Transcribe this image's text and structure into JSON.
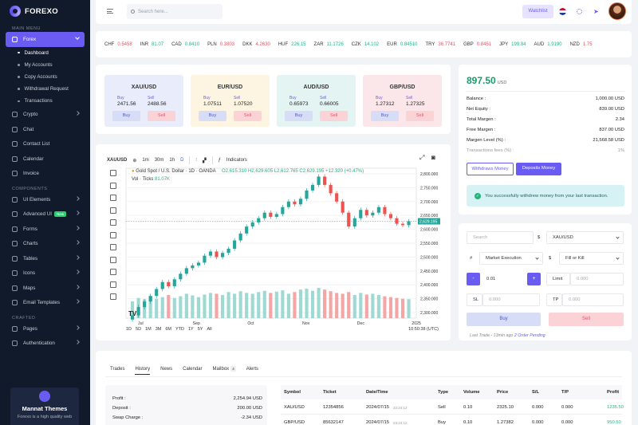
{
  "brand": "FOREXO",
  "sidebar": {
    "main_menu": "MAIN MENU",
    "forex": "Forex",
    "forex_sub": [
      "Dashboard",
      "My Accounts",
      "Copy Accounts",
      "Withdrawal Request",
      "Transactions"
    ],
    "items1": [
      "Crypto",
      "Chat",
      "Contact List",
      "Calendar",
      "Invoice"
    ],
    "components": "COMPONENTS",
    "items2": [
      "UI Elements",
      "Advanced UI",
      "Forms",
      "Charts",
      "Tables",
      "Icons",
      "Maps",
      "Email Templates"
    ],
    "new_badge": "New",
    "crafted": "CRAFTED",
    "items3": [
      "Pages",
      "Authentication"
    ],
    "promo_title": "Mannat Themes",
    "promo_text": "Forexo is a high quality web"
  },
  "topbar": {
    "search_placeholder": "Search here...",
    "watchlist": "Watchlist"
  },
  "ticker": [
    {
      "sym": "CHF",
      "val": "0.5458",
      "dir": "dn"
    },
    {
      "sym": "INR",
      "val": "81.07",
      "dir": "up"
    },
    {
      "sym": "CAD",
      "val": "0.8410",
      "dir": "up"
    },
    {
      "sym": "PLN",
      "val": "0.3803",
      "dir": "dn"
    },
    {
      "sym": "DKK",
      "val": "4.2630",
      "dir": "dn"
    },
    {
      "sym": "HUF",
      "val": "226.15",
      "dir": "up"
    },
    {
      "sym": "ZAR",
      "val": "11.1726",
      "dir": "up"
    },
    {
      "sym": "CZK",
      "val": "14.102",
      "dir": "up"
    },
    {
      "sym": "EUR",
      "val": "0.84510",
      "dir": "up"
    },
    {
      "sym": "TRY",
      "val": "36.7741",
      "dir": "dn"
    },
    {
      "sym": "GBP",
      "val": "0.8451",
      "dir": "dn"
    },
    {
      "sym": "JPY",
      "val": "199.84",
      "dir": "up"
    },
    {
      "sym": "AUD",
      "val": "1.9190",
      "dir": "up"
    },
    {
      "sym": "NZD",
      "val": "1.75",
      "dir": "dn"
    }
  ],
  "quotes": [
    {
      "sym": "XAU/USD",
      "buy": "2471.56",
      "sell": "2488.56",
      "bg": "#e8ecfb"
    },
    {
      "sym": "EUR/USD",
      "buy": "1.07511",
      "sell": "1.07520",
      "bg": "#fdf5e2"
    },
    {
      "sym": "AUD/USD",
      "buy": "0.65973",
      "sell": "0.66005",
      "bg": "#e3f4f3"
    },
    {
      "sym": "GBP/USD",
      "buy": "1.27312",
      "sell": "1.27325",
      "bg": "#fbe6ea"
    }
  ],
  "quote_labels": {
    "buy": "Buy",
    "sell": "Sell"
  },
  "chart": {
    "symbol": "XAUUSD",
    "intervals": [
      "1m",
      "30m",
      "1h",
      "D"
    ],
    "indicators": "Indicators",
    "title": "Gold Spot / U.S. Dollar · 1D · OANDA",
    "ohlc": "O2,615.310 H2,629.605 L2,612.765 C2,629.195 +12.320 (+0.47%)",
    "vol": "Vol · Ticks",
    "vol_val": "81.07K",
    "last_price": "2,629.195",
    "ranges": [
      "1D",
      "5D",
      "1M",
      "3M",
      "6M",
      "YTD",
      "1Y",
      "5Y",
      "All"
    ],
    "time": "10:50:38 (UTC)"
  },
  "chart_data": {
    "type": "candlestick",
    "x_ticks": [
      "Jul",
      "Sep",
      "Oct",
      "Nov",
      "Dec",
      "2025"
    ],
    "y_ticks": [
      2800,
      2750,
      2700,
      2650,
      2600,
      2550,
      2500,
      2450,
      2400,
      2350,
      2300
    ],
    "ylim": [
      2280,
      2820
    ],
    "close": [
      2290,
      2320,
      2340,
      2360,
      2385,
      2410,
      2395,
      2420,
      2440,
      2460,
      2470,
      2480,
      2505,
      2520,
      2500,
      2515,
      2530,
      2560,
      2585,
      2610,
      2625,
      2640,
      2660,
      2645,
      2655,
      2680,
      2700,
      2690,
      2710,
      2740,
      2760,
      2790,
      2760,
      2730,
      2700,
      2660,
      2610,
      2640,
      2670,
      2650,
      2660,
      2680,
      2655,
      2640,
      2620,
      2615,
      2629
    ],
    "volume": [
      40,
      48,
      45,
      52,
      46,
      50,
      55,
      48,
      52,
      58,
      54,
      50,
      56,
      60,
      58,
      55,
      62,
      58,
      64,
      60,
      58,
      62,
      65,
      60,
      63,
      66,
      58,
      62,
      68,
      70,
      65,
      72,
      68,
      64,
      60,
      58,
      62,
      55,
      60,
      56,
      58,
      55,
      52,
      50,
      48,
      46,
      45
    ]
  },
  "account": {
    "balance": "897.50",
    "currency": "USD",
    "rows": [
      {
        "k": "Balance :",
        "v": "1,000.00 USD"
      },
      {
        "k": "Net Equity :",
        "v": "839.00 USD"
      },
      {
        "k": "Total Margen :",
        "v": "2.34"
      },
      {
        "k": "Free Margen :",
        "v": "837.00 USD"
      },
      {
        "k": "Margen Level (%) :",
        "v": "21,568.58 USD"
      }
    ],
    "fees": {
      "k": "Transactions fees (%) :",
      "v": "1%"
    },
    "withdraw": "Withdraws Money",
    "deposit": "Deposits Money",
    "alert": "You successfully withdrew money from your last transaction."
  },
  "order": {
    "search": "Search",
    "pair": "XAU/USD",
    "exec": "Market Execution",
    "fill": "Fill or Kill",
    "qty": "0.01",
    "limit": "Limit",
    "limit_val": "0.000",
    "sl": "SL",
    "sl_val": "0.000",
    "tp": "TP",
    "tp_val": "0.000",
    "buy": "Buy",
    "sell": "Sell",
    "last_trade": "Last Trade - 13min ago",
    "pending": "2 Order Pending"
  },
  "history": {
    "tabs": [
      "Trades",
      "History",
      "News",
      "Calendar",
      "Mailbox",
      "Alerts"
    ],
    "mailbox_count": "4",
    "summary": [
      {
        "k": "Profit :",
        "v": "2,254.94 USD"
      },
      {
        "k": "Deposit :",
        "v": "200.00 USD"
      },
      {
        "k": "Swap Charge :",
        "v": "-2.34 USD"
      }
    ],
    "columns": [
      "Symbol",
      "Ticket",
      "Date/Time",
      "Type",
      "Volume",
      "Price",
      "S/L",
      "T/P",
      "Profit"
    ],
    "rows": [
      {
        "symbol": "XAU/USD",
        "ticket": "12354856",
        "date": "2024/07/15",
        "time": "23:24:12",
        "type": "Sell",
        "volume": "0.10",
        "price": "2325.10",
        "sl": "0.000",
        "tp": "0.000",
        "profit": "1235.50"
      },
      {
        "symbol": "GBP/USD",
        "ticket": "85632147",
        "date": "2024/07/15",
        "time": "23:24:12",
        "type": "Buy",
        "volume": "0.10",
        "price": "1.27382",
        "sl": "0.000",
        "tp": "0.000",
        "profit": "950.50"
      }
    ]
  }
}
